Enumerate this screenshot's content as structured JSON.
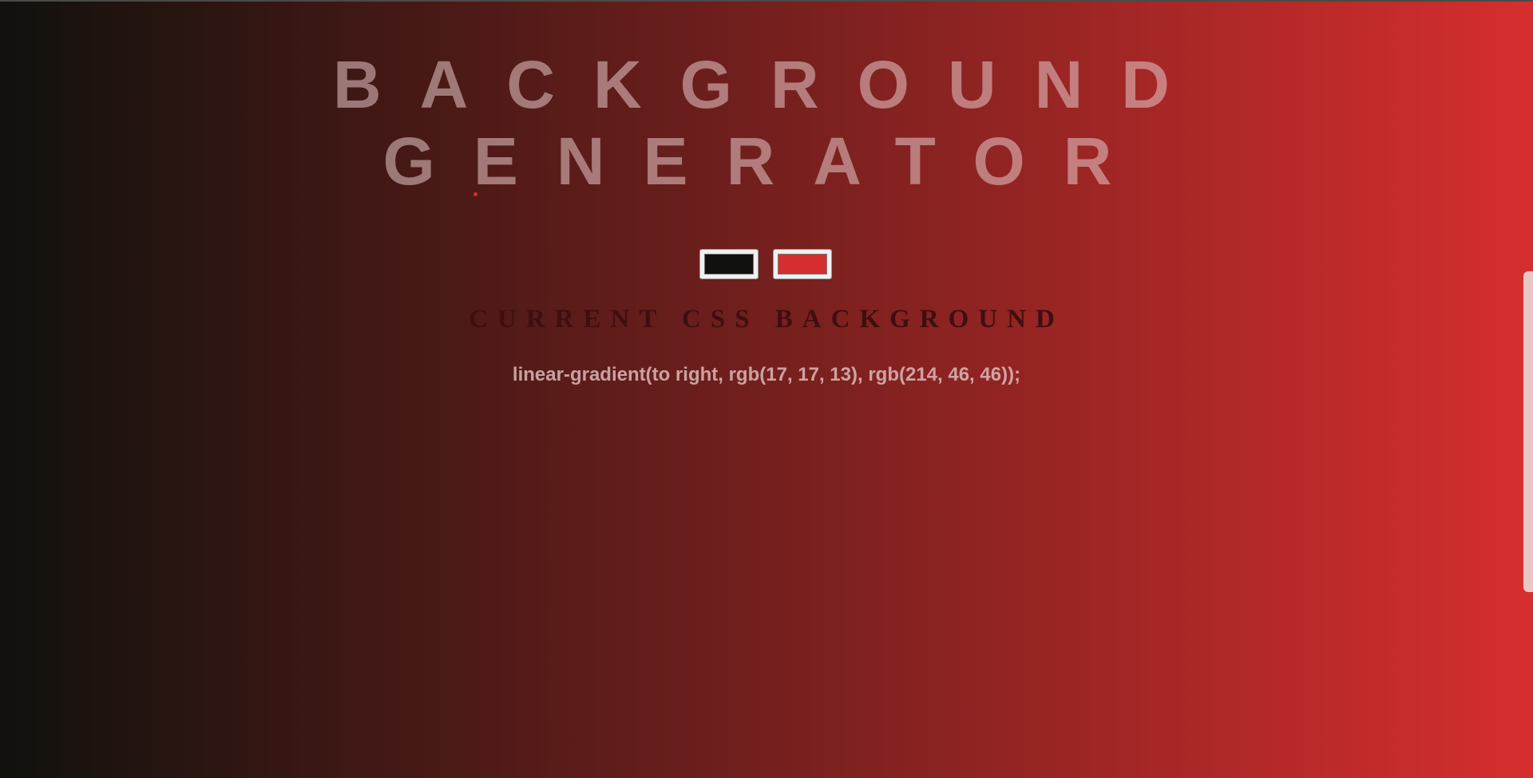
{
  "title": {
    "line1": "BACKGROUND",
    "line2": "GENERATOR"
  },
  "color_pickers": [
    {
      "value": "#11110d",
      "color": "#11110d"
    },
    {
      "value": "#d62e2e",
      "color": "#d62e2e"
    }
  ],
  "subtitle": "CURRENT CSS BACKGROUND",
  "css_value": "linear-gradient(to right, rgb(17, 17, 13), rgb(214, 46, 46));",
  "colors": {
    "gradient_start": "#11110d",
    "gradient_end": "#d62e2e",
    "accent_dot": "#e0282c"
  }
}
